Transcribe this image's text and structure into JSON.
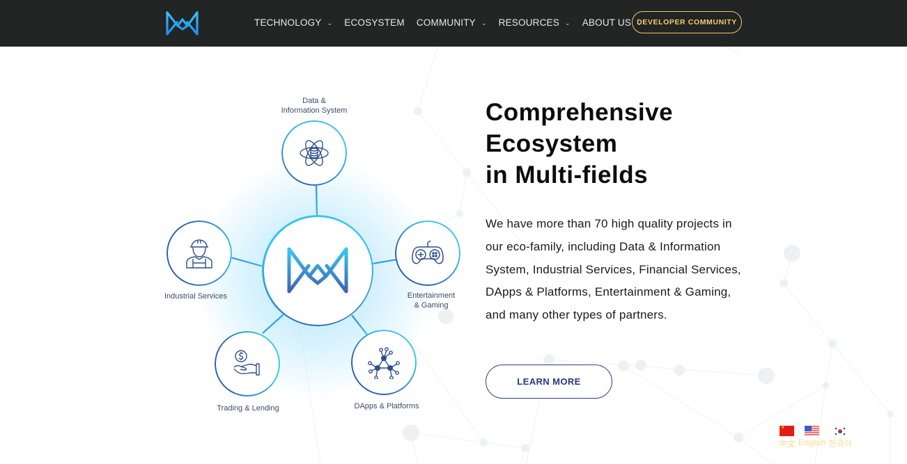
{
  "header": {
    "logo_name": "Brand logo",
    "nav": [
      {
        "label": "TECHNOLOGY",
        "has_dropdown": true
      },
      {
        "label": "ECOSYSTEM",
        "has_dropdown": false
      },
      {
        "label": "COMMUNITY",
        "has_dropdown": true
      },
      {
        "label": "RESOURCES",
        "has_dropdown": true
      },
      {
        "label": "ABOUT US",
        "has_dropdown": true
      }
    ],
    "chevron_glyph": "⌄",
    "cta_label": "DEVELOPER COMMUNITY"
  },
  "diagram": {
    "center_icon": "brand-logo-icon",
    "nodes": [
      {
        "id": "data",
        "label_lines": [
          "Data &",
          "Information System"
        ],
        "icon": "atom-database-icon"
      },
      {
        "id": "industrial",
        "label_lines": [
          "Industrial Services"
        ],
        "icon": "worker-hardhat-icon"
      },
      {
        "id": "entertainment",
        "label_lines": [
          "Entertainment",
          "& Gaming"
        ],
        "icon": "gamepad-icon"
      },
      {
        "id": "trading",
        "label_lines": [
          "Trading & Lending"
        ],
        "icon": "hand-coin-icon"
      },
      {
        "id": "dapps",
        "label_lines": [
          "DApps & Platforms"
        ],
        "icon": "network-nodes-icon"
      }
    ]
  },
  "main": {
    "heading_lines": [
      "Comprehensive",
      "Ecosystem",
      "in Multi-fields"
    ],
    "description": "We have more than 70 high quality projects in our eco-family, including Data & Information System, Industrial Services, Financial Services, DApps & Platforms, Entertainment & Gaming, and many other types of partners.",
    "learn_more_label": "LEARN MORE"
  },
  "language": {
    "options": [
      {
        "label": "中文",
        "flag": "china-flag-icon"
      },
      {
        "label": "English",
        "flag": "usa-flag-icon"
      },
      {
        "label": "한국어",
        "flag": "korea-flag-icon"
      }
    ]
  },
  "colors": {
    "header_bg": "#232424",
    "cta_gold": "#f0d070",
    "accent_blue": "#2fb4ea",
    "accent_navy": "#243a7c",
    "lang_label": "#f5dc8a"
  }
}
